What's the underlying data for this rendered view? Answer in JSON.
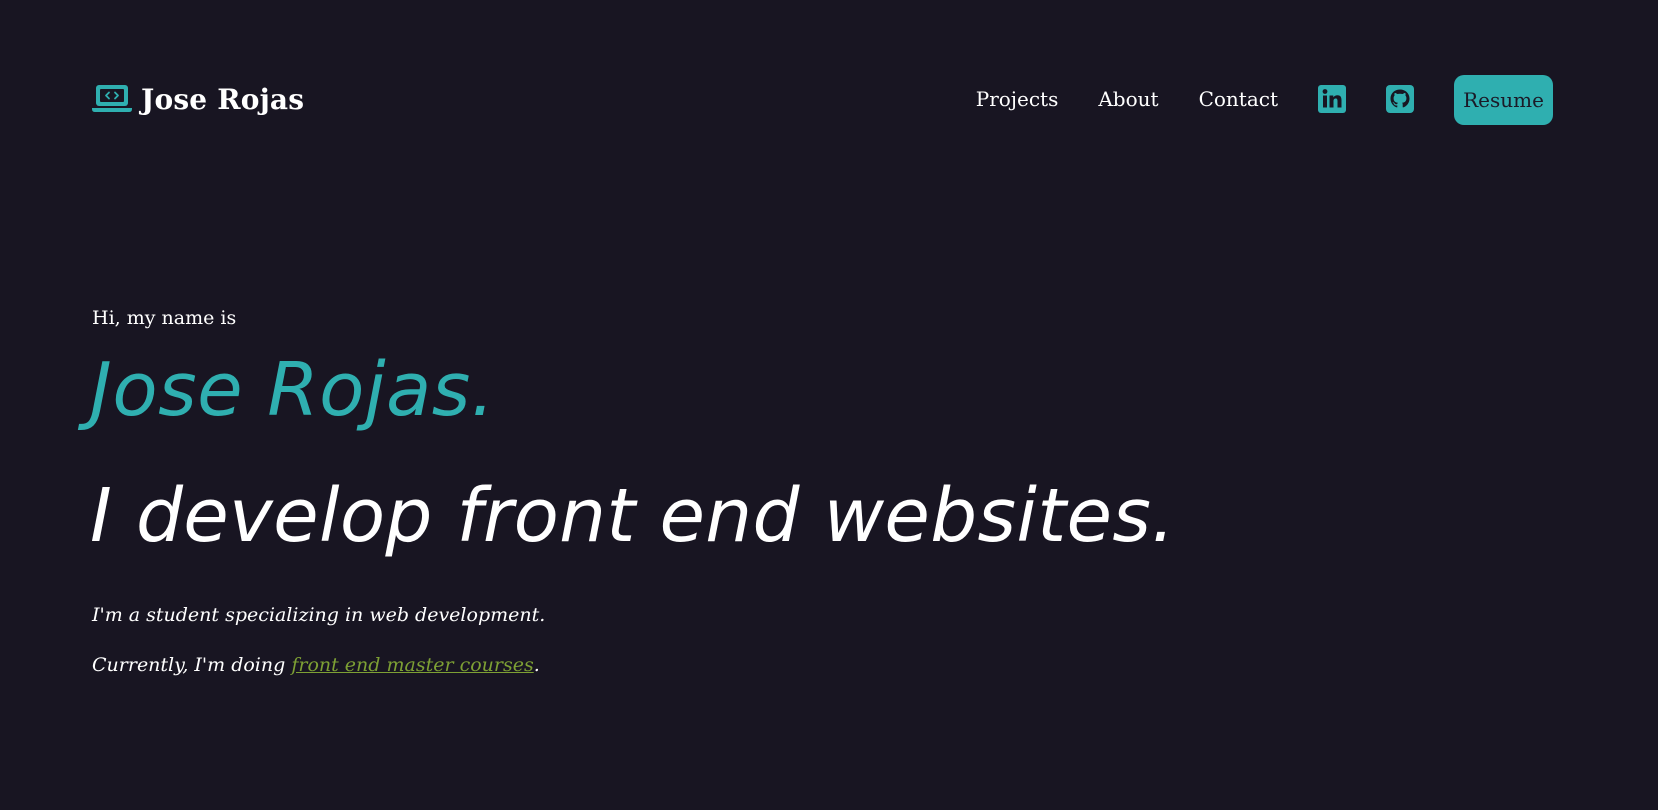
{
  "header": {
    "brand": {
      "icon": "laptop-code-icon",
      "name": "Jose Rojas"
    },
    "nav": {
      "links": [
        {
          "label": "Projects"
        },
        {
          "label": "About"
        },
        {
          "label": "Contact"
        }
      ],
      "social": [
        {
          "icon": "linkedin-icon"
        },
        {
          "icon": "github-icon"
        }
      ],
      "resume_label": "Resume"
    }
  },
  "hero": {
    "greeting": "Hi, my name is",
    "name": "Jose Rojas.",
    "tagline": "I develop front end websites.",
    "description": "I'm a student specializing in web development.",
    "current": {
      "prefix": "Currently, I'm doing ",
      "link_text": "front end master courses",
      "suffix": "."
    }
  },
  "colors": {
    "background": "#181522",
    "accent": "#2fafb0",
    "link": "#7da034",
    "text": "#ffffff",
    "button_text": "#1b1a27"
  }
}
